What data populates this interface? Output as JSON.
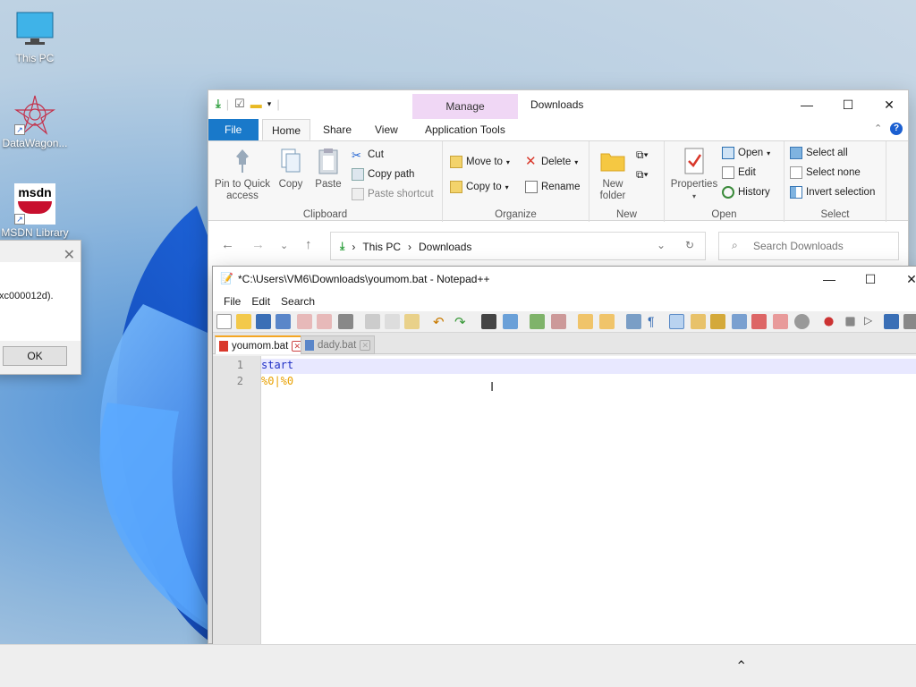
{
  "desktop": {
    "icons": [
      {
        "label": "This PC"
      },
      {
        "label": "DataWagon..."
      },
      {
        "label": "MSDN Library",
        "logo_text": "msdn"
      }
    ]
  },
  "error_dialog": {
    "message": "xc000012d).",
    "ok_label": "OK"
  },
  "explorer": {
    "title": "Downloads",
    "contextual_tab": "Manage",
    "tabs": [
      "File",
      "Home",
      "Share",
      "View",
      "Application Tools"
    ],
    "ribbon": {
      "clipboard": {
        "label": "Clipboard",
        "pin": "Pin to Quick access",
        "copy": "Copy",
        "paste": "Paste",
        "cut": "Cut",
        "copy_path": "Copy path",
        "paste_shortcut": "Paste shortcut"
      },
      "organize": {
        "label": "Organize",
        "move_to": "Move to",
        "copy_to": "Copy to",
        "delete": "Delete",
        "rename": "Rename"
      },
      "new": {
        "label": "New",
        "new_folder": "New folder"
      },
      "open": {
        "label": "Open",
        "properties": "Properties",
        "open": "Open",
        "edit": "Edit",
        "history": "History"
      },
      "select": {
        "label": "Select",
        "select_all": "Select all",
        "select_none": "Select none",
        "invert": "Invert selection"
      }
    },
    "address": {
      "crumbs": [
        "This PC",
        "Downloads"
      ],
      "search_placeholder": "Search Downloads"
    }
  },
  "notepadpp": {
    "title": "*C:\\Users\\VM6\\Downloads\\youmom.bat - Notepad++",
    "menu": [
      "File",
      "Edit",
      "Search"
    ],
    "tabs": [
      {
        "name": "youmom.bat",
        "active": true
      },
      {
        "name": "dady.bat",
        "active": false
      }
    ],
    "lines": [
      {
        "num": "1",
        "text": "start"
      },
      {
        "num": "2",
        "text": "%0|%0"
      }
    ]
  },
  "colors": {
    "file_tab": "#1979ca",
    "manage_tab": "#f0d7f5",
    "keyword": "#1f2fc4",
    "variable": "#e8a000"
  }
}
